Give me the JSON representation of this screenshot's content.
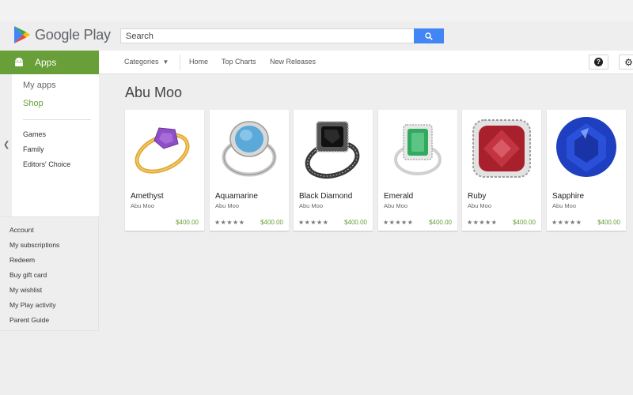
{
  "header": {
    "logo_text": "Google Play",
    "search_placeholder": "Search"
  },
  "nav": {
    "categories": "Categories",
    "home": "Home",
    "top_charts": "Top Charts",
    "new_releases": "New Releases",
    "help_symbol": "?"
  },
  "sidebar": {
    "apps_label": "Apps",
    "my_apps": "My apps",
    "shop": "Shop",
    "sub_items": [
      "Games",
      "Family",
      "Editors' Choice"
    ],
    "account_items": [
      "Account",
      "My subscriptions",
      "Redeem",
      "Buy gift card",
      "My wishlist",
      "My Play activity",
      "Parent Guide"
    ]
  },
  "page": {
    "title": "Abu Moo"
  },
  "cards": [
    {
      "title": "Amethyst",
      "developer": "Abu Moo",
      "stars": "",
      "price": "$400.00",
      "gem": "#8e4fc9",
      "metal": "#e0a93a"
    },
    {
      "title": "Aquamarine",
      "developer": "Abu Moo",
      "stars": "★★★★★",
      "price": "$400.00",
      "gem": "#5aa9d8",
      "metal": "#c9c9c9"
    },
    {
      "title": "Black Diamond",
      "developer": "Abu Moo",
      "stars": "★★★★★",
      "price": "$400.00",
      "gem": "#1a1a1a",
      "metal": "#3a3a3a"
    },
    {
      "title": "Emerald",
      "developer": "Abu Moo",
      "stars": "★★★★★",
      "price": "$400.00",
      "gem": "#2faa5f",
      "metal": "#d0d0d0"
    },
    {
      "title": "Ruby",
      "developer": "Abu Moo",
      "stars": "★★★★★",
      "price": "$400.00",
      "gem": "#a8202c",
      "metal": "#cfcfcf"
    },
    {
      "title": "Sapphire",
      "developer": "Abu Moo",
      "stars": "★★★★★",
      "price": "$400.00",
      "gem": "#1e3fbf",
      "metal": "#1e3fbf"
    }
  ],
  "colors": {
    "accent_green": "#689f38",
    "search_blue": "#4285f4"
  }
}
